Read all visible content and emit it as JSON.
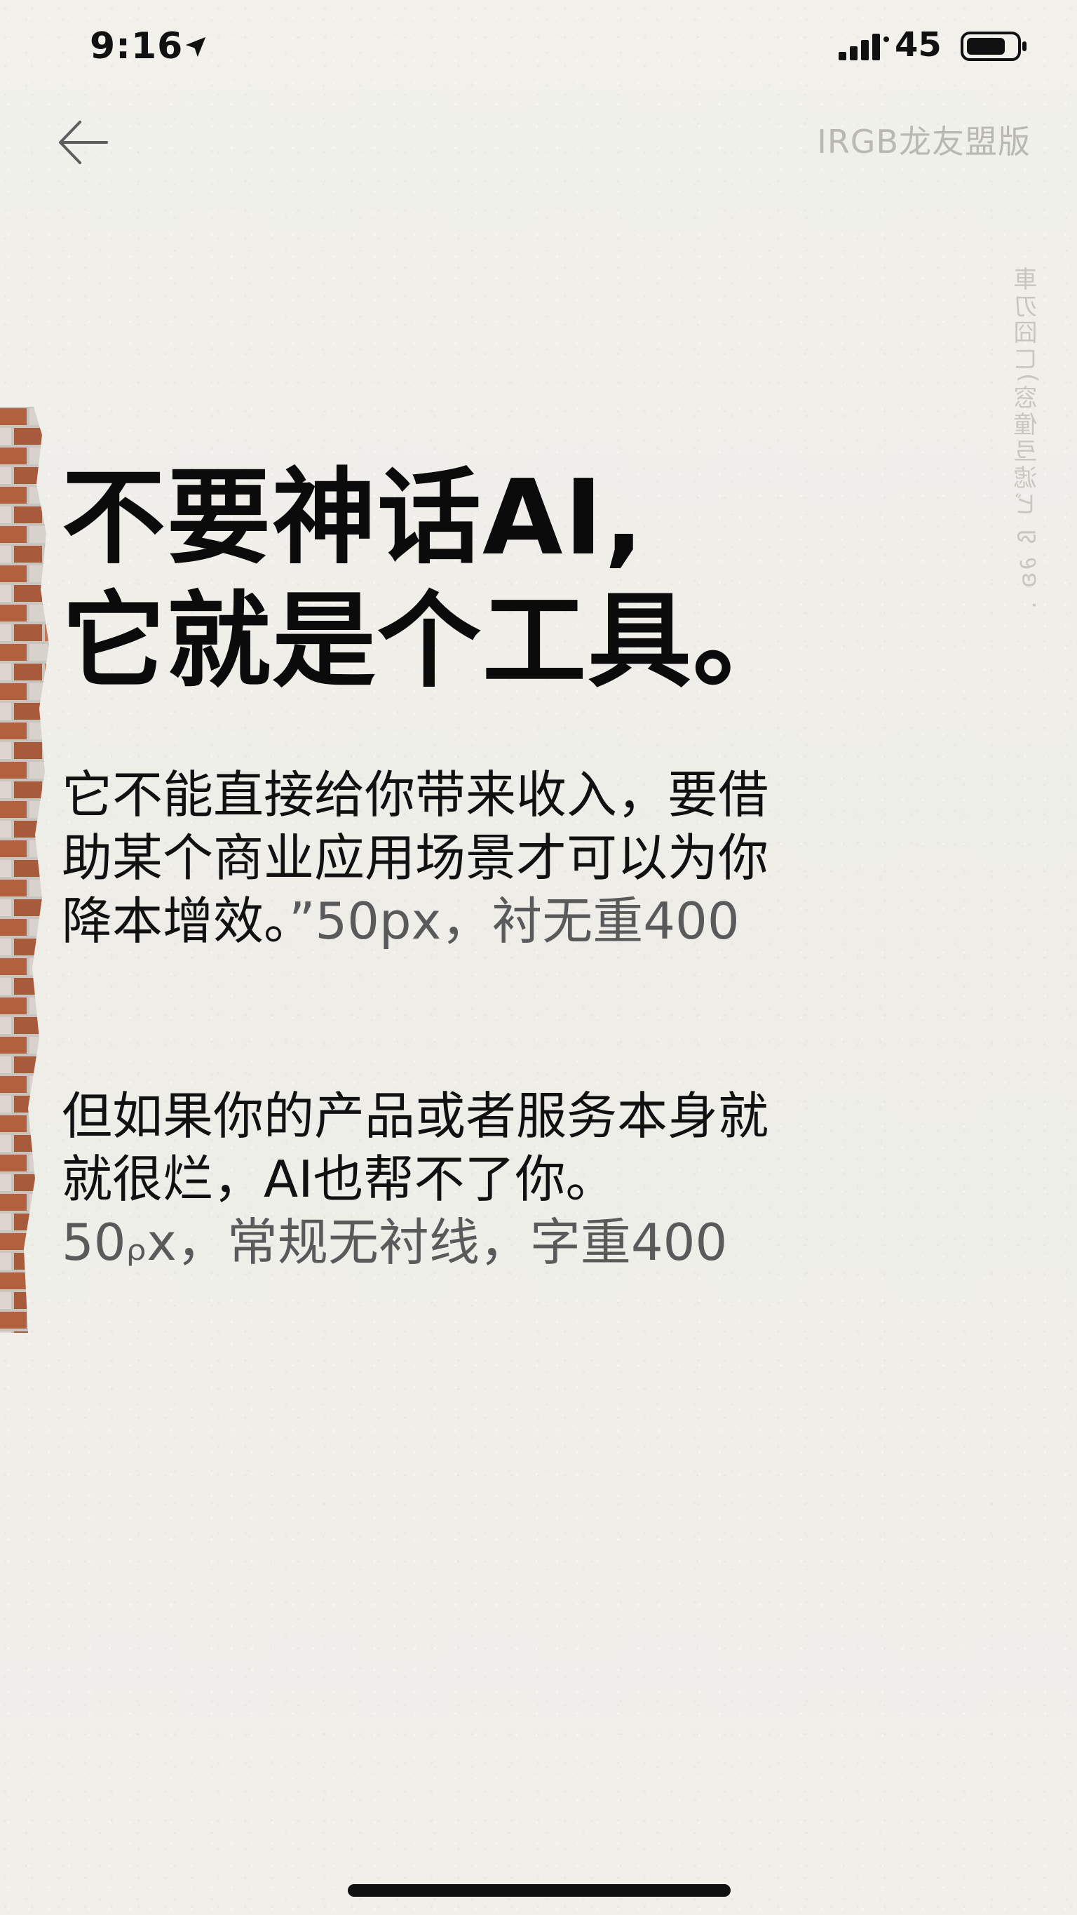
{
  "status_bar": {
    "time": "9:16",
    "network": "45"
  },
  "watermark": {
    "text": "IRGB龙友盟版",
    "vertical_text": "車刃囧ㄈ(窓僮弖滤ビ ß ∂ʚ ."
  },
  "content": {
    "headline_line1": "不要神话AI,",
    "headline_line2": "它就是个工具。",
    "paragraph1_text": "它不能直接给你带来收入，要借\n助某个商业应用场景才可以为你\n降本增效。",
    "paragraph1_annotation": "”50px，衬无重400",
    "paragraph2_text": "但如果你的产品或者服务本身就\n就很烂，AI也帮不了你。",
    "paragraph2_annotation": "50ᵨx，常规无衬线，字重400"
  },
  "colors": {
    "background": "#efeee9",
    "text": "#111111",
    "annotation": "#5a5a5a",
    "watermark": "#b9b8b3"
  },
  "icons": {
    "back": "arrow-left-icon",
    "location": "location-arrow-icon",
    "signal": "cellular-signal-icon",
    "battery": "battery-icon"
  }
}
